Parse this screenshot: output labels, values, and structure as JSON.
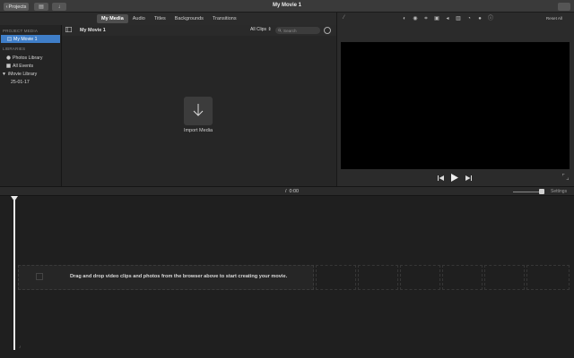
{
  "titlebar": {
    "projects_label": "Projects",
    "window_title": "My Movie 1"
  },
  "tabs": [
    {
      "label": "My Media",
      "active": true
    },
    {
      "label": "Audio",
      "active": false
    },
    {
      "label": "Titles",
      "active": false
    },
    {
      "label": "Backgrounds",
      "active": false
    },
    {
      "label": "Transitions",
      "active": false
    }
  ],
  "sidebar": {
    "project_media_header": "PROJECT MEDIA",
    "project_item": "My Movie 1",
    "libraries_header": "LIBRARIES",
    "photos_library": "Photos Library",
    "all_events": "All Events",
    "movie_library": "iMovie Library",
    "event": "25-01-17"
  },
  "browser": {
    "title": "My Movie 1",
    "clips_filter": "All Clips",
    "search_placeholder": "Search",
    "import_label": "Import Media"
  },
  "viewer": {
    "reset_all": "Reset All"
  },
  "timeline": {
    "timecode_sep": "/",
    "timecode": "0:00",
    "settings_label": "Settings",
    "drop_hint": "Drag and drop video clips and photos from the browser above to start creating your movie."
  },
  "colors": {
    "accent": "#3f7ec8",
    "video_bg": "#000000",
    "panel_bg": "#262626"
  }
}
